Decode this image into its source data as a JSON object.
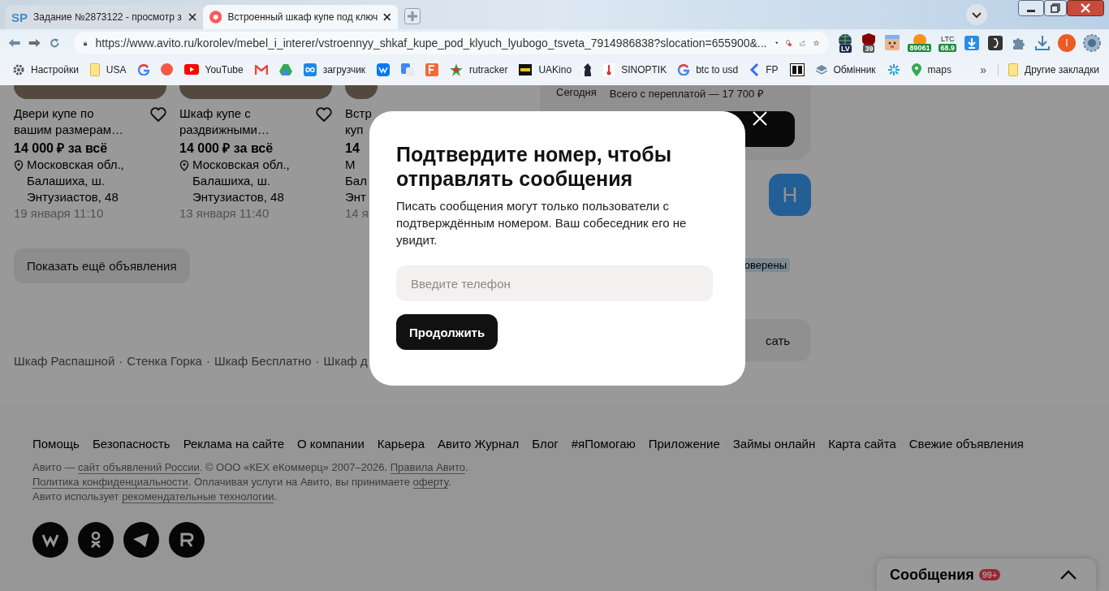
{
  "browser": {
    "tabs": [
      {
        "favicon_text": "SP",
        "title": "Задание №2873122 - просмотр з",
        "selected": false
      },
      {
        "title": "Встроенный шкаф купе под ключ",
        "selected": true
      }
    ],
    "address": "https://www.avito.ru/korolev/mebel_i_interer/vstroennyy_shkaf_kupe_pod_klyuch_lyubogo_tsveta_7914986838?slocation=655900&...",
    "extensions": [
      {
        "kind": "globe",
        "badge": "LV"
      },
      {
        "kind": "shield",
        "badge": "39"
      },
      {
        "kind": "face"
      },
      {
        "kind": "coin",
        "badge": "89061"
      },
      {
        "kind": "ltc",
        "label": "LTC",
        "badge": "68.9"
      },
      {
        "kind": "download-box"
      },
      {
        "kind": "dark-box"
      },
      {
        "kind": "puzzle"
      },
      {
        "kind": "download"
      },
      {
        "kind": "avatar",
        "label": "I"
      },
      {
        "kind": "orb"
      }
    ],
    "bookmarks": [
      {
        "kind": "gear",
        "label": "Настройки"
      },
      {
        "kind": "folder",
        "label": "USA"
      },
      {
        "kind": "g-logo"
      },
      {
        "kind": "round"
      },
      {
        "kind": "play",
        "label": "YouTube"
      },
      {
        "kind": "envelope"
      },
      {
        "kind": "triangle"
      },
      {
        "kind": "infinity",
        "label": "загрузчик"
      },
      {
        "kind": "blue-square"
      },
      {
        "kind": "translate"
      },
      {
        "kind": "f-square"
      },
      {
        "kind": "star",
        "label": "rutracker"
      },
      {
        "kind": "film",
        "label": "UAKino"
      },
      {
        "kind": "chess"
      },
      {
        "kind": "thermometer",
        "label": "SINOPTIK"
      },
      {
        "kind": "g-logo",
        "label": "btc to usd"
      },
      {
        "kind": "chevron",
        "label": "FP"
      },
      {
        "kind": "bc-box"
      },
      {
        "kind": "layers",
        "label": "Обмінник"
      },
      {
        "kind": "pinwheel"
      },
      {
        "kind": "map-pin",
        "label": "maps"
      }
    ],
    "more": "»",
    "other_bookmarks": "Другие закладки"
  },
  "listings": [
    {
      "title": "Двери купе по вашим размерам…",
      "price": "14 000 ₽ за всё",
      "location": "Московская обл., Балашиха, ш. Энтузиастов, 48",
      "date": "19 января 11:10",
      "favorite": false
    },
    {
      "title": "Шкаф купе с раздвижными…",
      "price": "14 000 ₽ за всё",
      "location": "Московская обл., Балашиха, ш. Энтузиастов, 48",
      "date": "13 января 11:40",
      "favorite": false
    }
  ],
  "partial_listing": {
    "title_lines": [
      "Встр",
      "куп"
    ],
    "price": "14",
    "location_lines": [
      "М",
      "Бал",
      "Энт"
    ],
    "date": "14 я"
  },
  "show_more": "Показать ещё объявления",
  "related": {
    "separator": "·",
    "links": [
      "Шкаф Распашной",
      "Стенка Горка",
      "Шкаф Бесплатно",
      "Шкаф д"
    ]
  },
  "side": {
    "day": "Сегодня",
    "total": "Всего с переплатой — 17 700 ₽",
    "avatar": "Н",
    "badge": "оверены",
    "button": "сать"
  },
  "modal": {
    "title": "Подтвердите номер, чтобы отправлять сообщения",
    "text": "Писать сообщения могут только пользователи с подтверждённым номером. Ваш собеседник его не увидит.",
    "phone_placeholder": "Введите телефон",
    "submit": "Продолжить"
  },
  "footer": {
    "nav": [
      "Помощь",
      "Безопасность",
      "Реклама на сайте",
      "О компании",
      "Карьера",
      "Авито Журнал",
      "Блог",
      "#яПомогаю",
      "Приложение",
      "Займы онлайн",
      "Карта сайта",
      "Свежие объявления"
    ],
    "legal": [
      [
        {
          "kind": "text",
          "text": "Авито — "
        },
        {
          "kind": "link",
          "text": "сайт объявлений России"
        },
        {
          "kind": "text",
          "text": ". © ООО «КЕХ еКоммерц» 2007–2026. "
        },
        {
          "kind": "link",
          "text": "Правила Авито"
        },
        {
          "kind": "text",
          "text": "."
        }
      ],
      [
        {
          "kind": "link",
          "text": "Политика конфиденциальности"
        },
        {
          "kind": "text",
          "text": ". Оплачивая услуги на Авито, вы принимаете "
        },
        {
          "kind": "link",
          "text": "оферту"
        },
        {
          "kind": "text",
          "text": "."
        }
      ],
      [
        {
          "kind": "text",
          "text": "Авито использует "
        },
        {
          "kind": "link",
          "text": "рекомендательные технологии"
        },
        {
          "kind": "text",
          "text": "."
        }
      ]
    ]
  },
  "messages": {
    "title": "Сообщения",
    "count": "99+"
  }
}
